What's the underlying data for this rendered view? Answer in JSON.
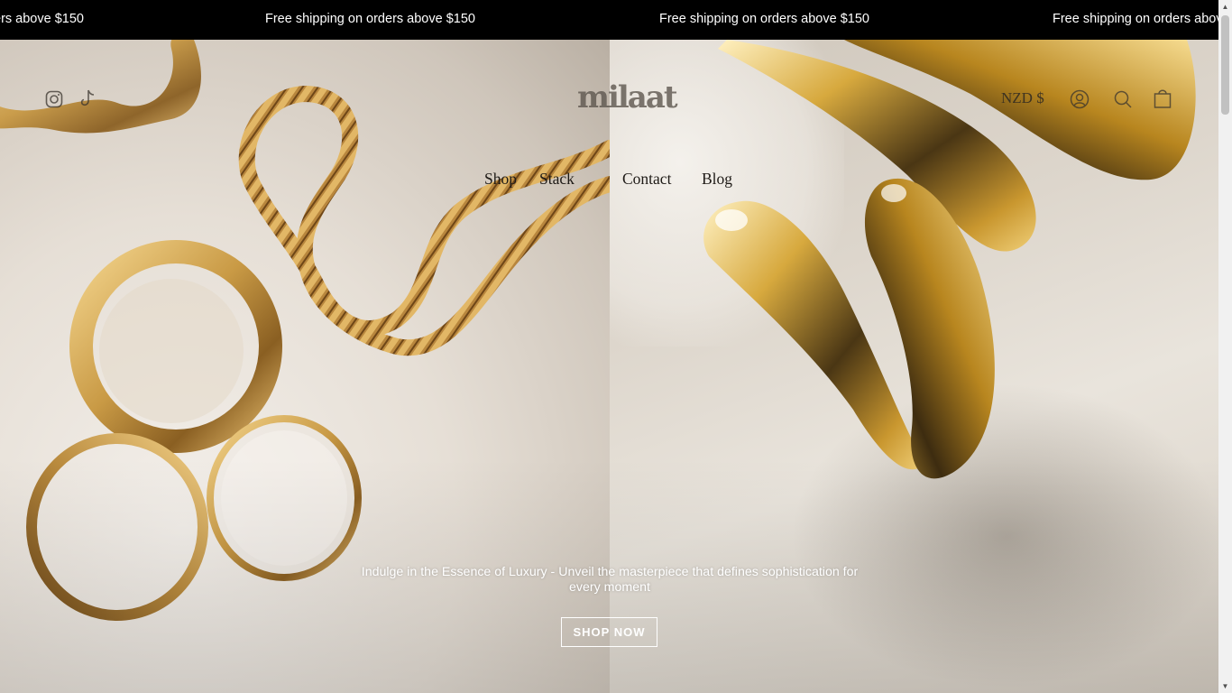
{
  "announcement": {
    "messages": [
      "Free shipping on orders above $150",
      "Free shipping on orders above $150",
      "Free shipping on orders above $150",
      "Free shipping on orders above $150"
    ]
  },
  "header": {
    "logo_text": "milaat",
    "currency": "NZD $",
    "nav": [
      "Shop",
      "Stack",
      "Contact",
      "Blog"
    ],
    "icons": {
      "social": [
        "instagram-icon",
        "tiktok-icon"
      ],
      "utility": [
        "account-icon",
        "search-icon",
        "cart-icon"
      ]
    }
  },
  "hero": {
    "tagline": "Indulge in the Essence of Luxury - Unveil the masterpiece that defines sophistication for every moment",
    "button_label": "SHOP NOW"
  },
  "colors": {
    "announcement_bg": "#000000",
    "announcement_text": "#ffffff",
    "gold": "#c9a14a",
    "cta_border": "#ffffff"
  }
}
